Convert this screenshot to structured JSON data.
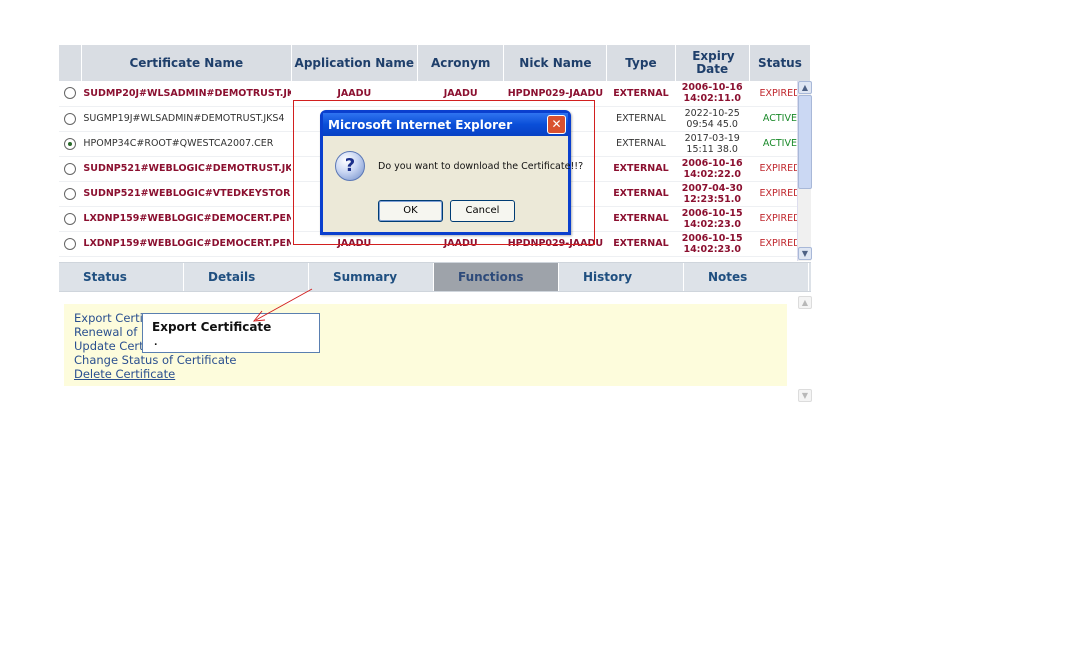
{
  "table": {
    "headers": [
      "",
      "Certificate Name",
      "Application Name",
      "Acronym",
      "Nick Name",
      "Type",
      "Expiry Date",
      "Status"
    ],
    "rows": [
      {
        "selected": false,
        "name": "SUDMP20J#WLSADMIN#DEMOTRUST.JK",
        "app": "JAADU",
        "acronym": "JAADU",
        "nick": "HPDNP029-JAADU",
        "type": "EXTERNAL",
        "date": "2006-10-16",
        "time": "14:02:11.0",
        "status": "EXPIRED",
        "highlight": true
      },
      {
        "selected": false,
        "name": "SUGMP19J#WLSADMIN#DEMOTRUST.JKS4",
        "app": "",
        "acronym": "",
        "nick": "ADU",
        "type": "EXTERNAL",
        "date": "2022-10-25",
        "time": "09:54 45.0",
        "status": "ACTIVE",
        "highlight": false
      },
      {
        "selected": true,
        "name": "HPOMP34C#ROOT#QWESTCA2007.CER",
        "app": "",
        "acronym": "",
        "nick": "ADU",
        "type": "EXTERNAL",
        "date": "2017-03-19",
        "time": "15:11 38.0",
        "status": "ACTIVE",
        "highlight": false
      },
      {
        "selected": false,
        "name": "SUDNP521#WEBLOGIC#DEMOTRUST.JK:",
        "app": "",
        "acronym": "",
        "nick": "ADU",
        "type": "EXTERNAL",
        "date": "2006-10-16",
        "time": "14:02:22.0",
        "status": "EXPIRED",
        "highlight": true
      },
      {
        "selected": false,
        "name": "SUDNP521#WEBLOGIC#VTEDKEYSTORE",
        "app": "",
        "acronym": "",
        "nick": "ADU",
        "type": "EXTERNAL",
        "date": "2007-04-30",
        "time": "12:23:51.0",
        "status": "EXPIRED",
        "highlight": true
      },
      {
        "selected": false,
        "name": "LXDNP159#WEBLOGIC#DEMOCERT.PEM",
        "app": "",
        "acronym": "",
        "nick": "ADU",
        "type": "EXTERNAL",
        "date": "2006-10-15",
        "time": "14:02:23.0",
        "status": "EXPIRED",
        "highlight": true
      },
      {
        "selected": false,
        "name": "LXDNP159#WEBLOGIC#DEMOCERT.PEM",
        "app": "JAADU",
        "acronym": "JAADU",
        "nick": "HPDNP029-JAADU",
        "type": "EXTERNAL",
        "date": "2006-10-15",
        "time": "14:02:23.0",
        "status": "EXPIRED",
        "highlight": true
      }
    ]
  },
  "tabs": [
    "Status",
    "Details",
    "Summary",
    "Functions",
    "History",
    "Notes"
  ],
  "active_tab": "Functions",
  "functions": {
    "links": [
      "Export Certi",
      "Renewal of",
      "Update Cert",
      "Change Status of Certificate",
      "Delete Certificate"
    ]
  },
  "callout": {
    "label": "Export Certificate",
    "dot": "."
  },
  "dialog": {
    "title": "Microsoft Internet Explorer",
    "message": "Do you want to download the Certificate!!?",
    "ok_label": "OK",
    "cancel_label": "Cancel",
    "close_glyph": "✕",
    "icon_glyph": "?"
  },
  "scroll": {
    "up": "▲",
    "down": "▼"
  },
  "colors": {
    "highlight_row": "#8b1030",
    "expired": "#c0272d",
    "active": "#1a8a2a",
    "annotation": "#d21f1f"
  }
}
